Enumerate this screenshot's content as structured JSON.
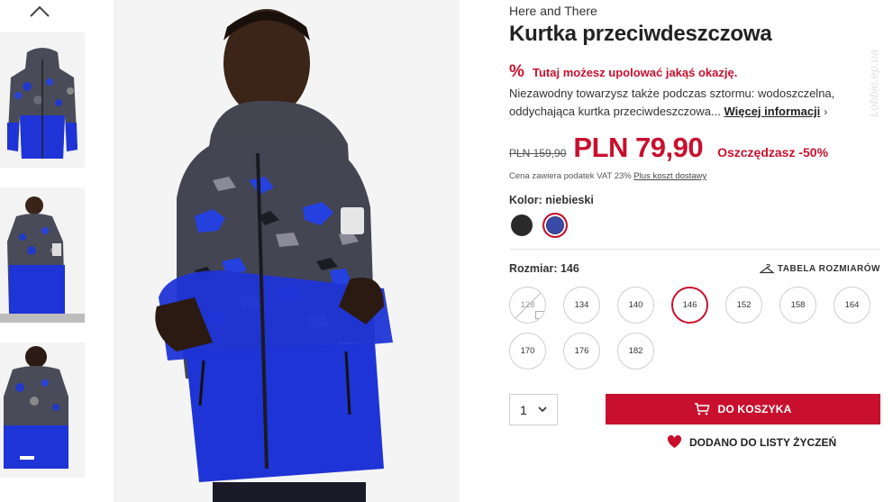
{
  "gallery": {
    "thumbnails": [
      "front-view",
      "model-front-view",
      "model-back-view"
    ]
  },
  "product": {
    "brand": "Here and There",
    "title": "Kurtka przeciwdeszczowa",
    "promo_icon": "%",
    "promo_text": "Tutaj możesz upolować jakąś okazję.",
    "description": "Niezawodny towarzysz także podczas sztormu: wodoszczelna, oddychająca kurtka przeciwdeszczowa...",
    "more_info_label": "Więcej informacji",
    "old_price": "PLN 159,90",
    "new_price": "PLN 79,90",
    "savings": "Oszczędzasz -50%",
    "vat_text": "Cena zawiera podatek VAT 23%",
    "shipping_link": "Plus koszt dostawy",
    "color_label": "Kolor:",
    "color_value": "niebieski",
    "colors": [
      {
        "name": "czarny",
        "hex": "#2a2a2a",
        "selected": false
      },
      {
        "name": "niebieski",
        "hex": "#3a4aa6",
        "selected": true
      }
    ],
    "size_label": "Rozmiar:",
    "size_value": "146",
    "size_table_label": "TABELA ROZMIARÓW",
    "sizes": [
      {
        "label": "128",
        "available": false,
        "selected": false
      },
      {
        "label": "134",
        "available": true,
        "selected": false
      },
      {
        "label": "140",
        "available": true,
        "selected": false
      },
      {
        "label": "146",
        "available": true,
        "selected": true
      },
      {
        "label": "152",
        "available": true,
        "selected": false
      },
      {
        "label": "158",
        "available": true,
        "selected": false
      },
      {
        "label": "164",
        "available": true,
        "selected": false
      },
      {
        "label": "170",
        "available": true,
        "selected": false
      },
      {
        "label": "176",
        "available": true,
        "selected": false
      },
      {
        "label": "182",
        "available": true,
        "selected": false
      }
    ],
    "quantity": "1",
    "cart_button_label": "DO KOSZYKA",
    "wishlist_label": "DODANO DO LISTY ŻYCZEŃ"
  },
  "colors": {
    "accent": "#c8102e",
    "jacket_blue": "#1f34d6",
    "jacket_camo_dark": "#3b3b46"
  },
  "watermark": "Lobbie.ep.ua"
}
